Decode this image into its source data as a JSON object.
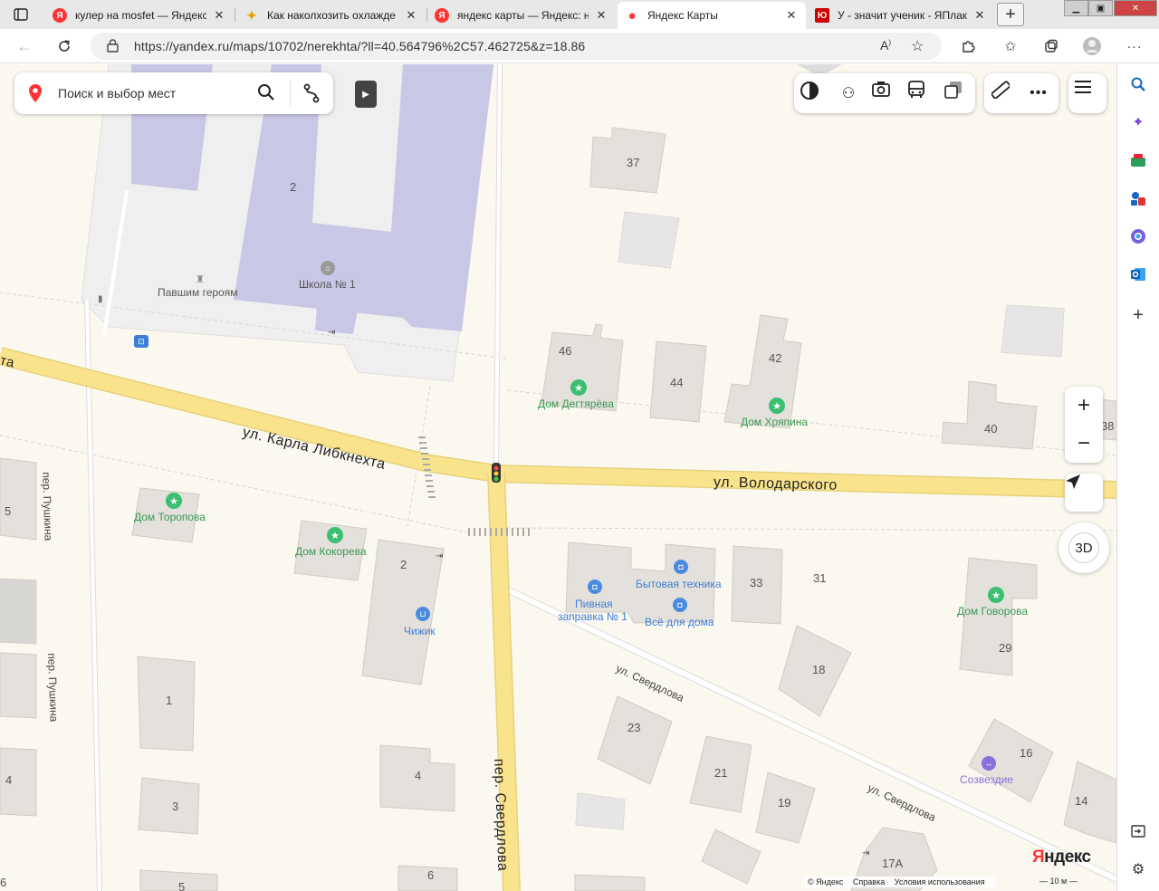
{
  "tabs": [
    {
      "title": "кулер на mosfet — Яндекс",
      "favicon": "Я",
      "favicon_color": "#f33",
      "active": false
    },
    {
      "title": "Как наколхозить охлажде",
      "favicon": "✦",
      "favicon_color": "#e8a000",
      "active": false
    },
    {
      "title": "яндекс карты — Яндекс: н",
      "favicon": "Я",
      "favicon_color": "#f33",
      "active": false
    },
    {
      "title": "Яндекс Карты",
      "favicon": "●",
      "favicon_color": "#f33",
      "active": true
    },
    {
      "title": "У - значит ученик - ЯПлак",
      "favicon": "Ю",
      "favicon_color": "#c00",
      "active": false
    }
  ],
  "address": {
    "url": "https://yandex.ru/maps/10702/nerekhta/?ll=40.564796%2C57.462725&z=18.86"
  },
  "search": {
    "placeholder": "Поиск и выбор мест"
  },
  "map": {
    "streets": {
      "karla_libknehta": "ул. Карла Либкнехта",
      "volodarskogo": "ул. Володарского",
      "sverdlova_lane": "пер. Свердлова",
      "pushkina_1": "пер. Пушкина",
      "pushkina_2": "пер. Пушкина",
      "sverdlova_1": "ул. Свердлова",
      "sverdlova_2": "ул. Свердлова",
      "ta_fragment": "та"
    },
    "pois": {
      "school": "Школа № 1",
      "monument": "Павшим героям",
      "degtyareva": "Дом Дегтярёва",
      "khryapina": "Дом Хряпина",
      "toropova": "Дом Торопова",
      "kokoreva": "Дом Кокорева",
      "govorova": "Дом Говорова",
      "chizhik": "Чижик",
      "appliances": "Бытовая техника",
      "beer_line1": "Пивная",
      "beer_line2": "заправка № 1",
      "home_goods": "Всё для дома",
      "sozvezdie": "Созвездие"
    },
    "house_numbers": {
      "n37": "37",
      "n2a": "2",
      "n46": "46",
      "n44": "44",
      "n42": "42",
      "n40": "40",
      "n38": "38",
      "n5a": "5",
      "n2b": "2",
      "n33": "33",
      "n31": "31",
      "n29": "29",
      "n18": "18",
      "n1": "1",
      "n23": "23",
      "n21": "21",
      "n19": "19",
      "n16": "16",
      "n14": "14",
      "n4a": "4",
      "n4b": "4",
      "n3": "3",
      "n17a": "17А",
      "n6a": "6",
      "n6b": "6",
      "n5b": "5"
    },
    "controls": {
      "zoom_in": "+",
      "zoom_out": "−",
      "btn_3d": "3D"
    },
    "logo": "Яндекс",
    "copyright": [
      "© Яндекс",
      "Справка",
      "Условия использования"
    ],
    "scale": "10 м"
  },
  "colors": {
    "road": "#fae38d",
    "background": "#fbf8ef",
    "building": "#e4e1dc",
    "school": "#c9c7e6",
    "yandex_red": "#ff3333"
  }
}
